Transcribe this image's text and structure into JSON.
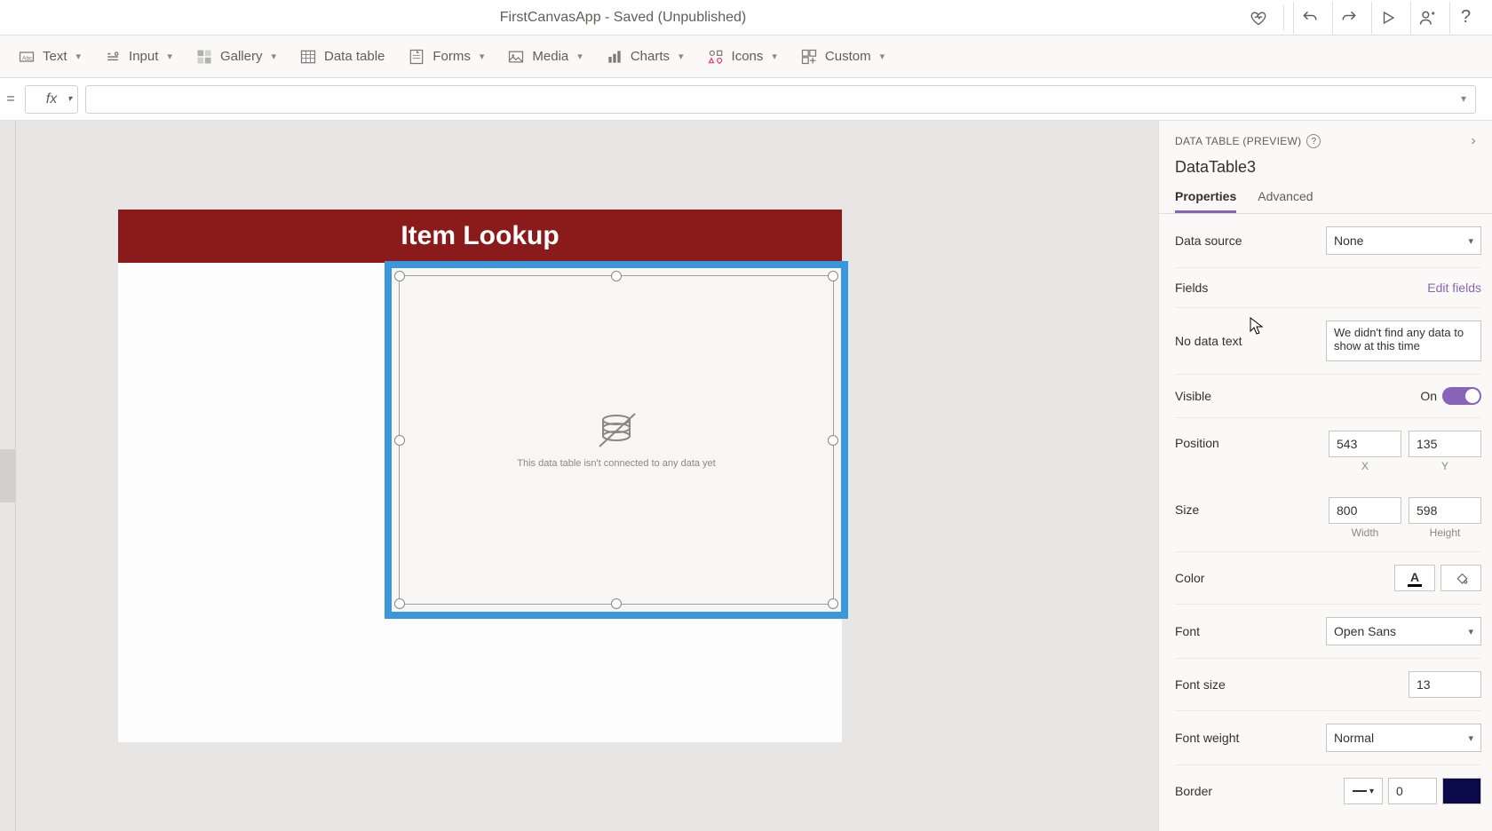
{
  "titlebar": {
    "title": "FirstCanvasApp - Saved (Unpublished)"
  },
  "ribbon": {
    "text": "Text",
    "input": "Input",
    "gallery": "Gallery",
    "datatable": "Data table",
    "forms": "Forms",
    "media": "Media",
    "charts": "Charts",
    "icons": "Icons",
    "custom": "Custom"
  },
  "formula": {
    "eq": "=",
    "fx": "fx",
    "value": ""
  },
  "canvas": {
    "header": "Item Lookup",
    "datatable_msg": "This data table isn't connected to any data yet"
  },
  "panel": {
    "breadcrumb": "DATA TABLE (PREVIEW)",
    "name": "DataTable3",
    "tabs": {
      "properties": "Properties",
      "advanced": "Advanced"
    },
    "props": {
      "data_source_label": "Data source",
      "data_source_value": "None",
      "fields_label": "Fields",
      "fields_link": "Edit fields",
      "no_data_label": "No data text",
      "no_data_value": "We didn't find any data to show at this time",
      "visible_label": "Visible",
      "visible_value": "On",
      "position_label": "Position",
      "position_x": "543",
      "position_y": "135",
      "x_label": "X",
      "y_label": "Y",
      "size_label": "Size",
      "size_w": "800",
      "size_h": "598",
      "w_label": "Width",
      "h_label": "Height",
      "color_label": "Color",
      "font_label": "Font",
      "font_value": "Open Sans",
      "fontsize_label": "Font size",
      "fontsize_value": "13",
      "fontweight_label": "Font weight",
      "fontweight_value": "Normal",
      "border_label": "Border",
      "border_value": "0"
    }
  }
}
